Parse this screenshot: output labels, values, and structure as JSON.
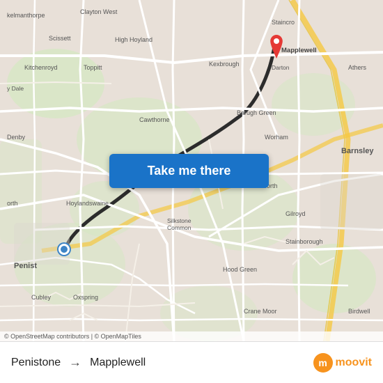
{
  "map": {
    "attribution": "© OpenStreetMap contributors | © OpenMapTiles",
    "origin": "Penistone",
    "destination": "Mapplewell"
  },
  "button": {
    "label": "Take me there"
  },
  "footer": {
    "origin": "Penistone",
    "arrow": "→",
    "destination": "Mapplewell",
    "brand": "moovit"
  },
  "colors": {
    "button_bg": "#1a73c8",
    "origin_dot": "#3d84c6",
    "destination_pin": "#e53935",
    "road_major": "#ffffff",
    "road_minor": "#f5f0e8",
    "water": "#b3d1e8",
    "land": "#e8e0d8",
    "green": "#d4e8c2",
    "route": "#2c2c2c",
    "accent": "#f7931e"
  }
}
